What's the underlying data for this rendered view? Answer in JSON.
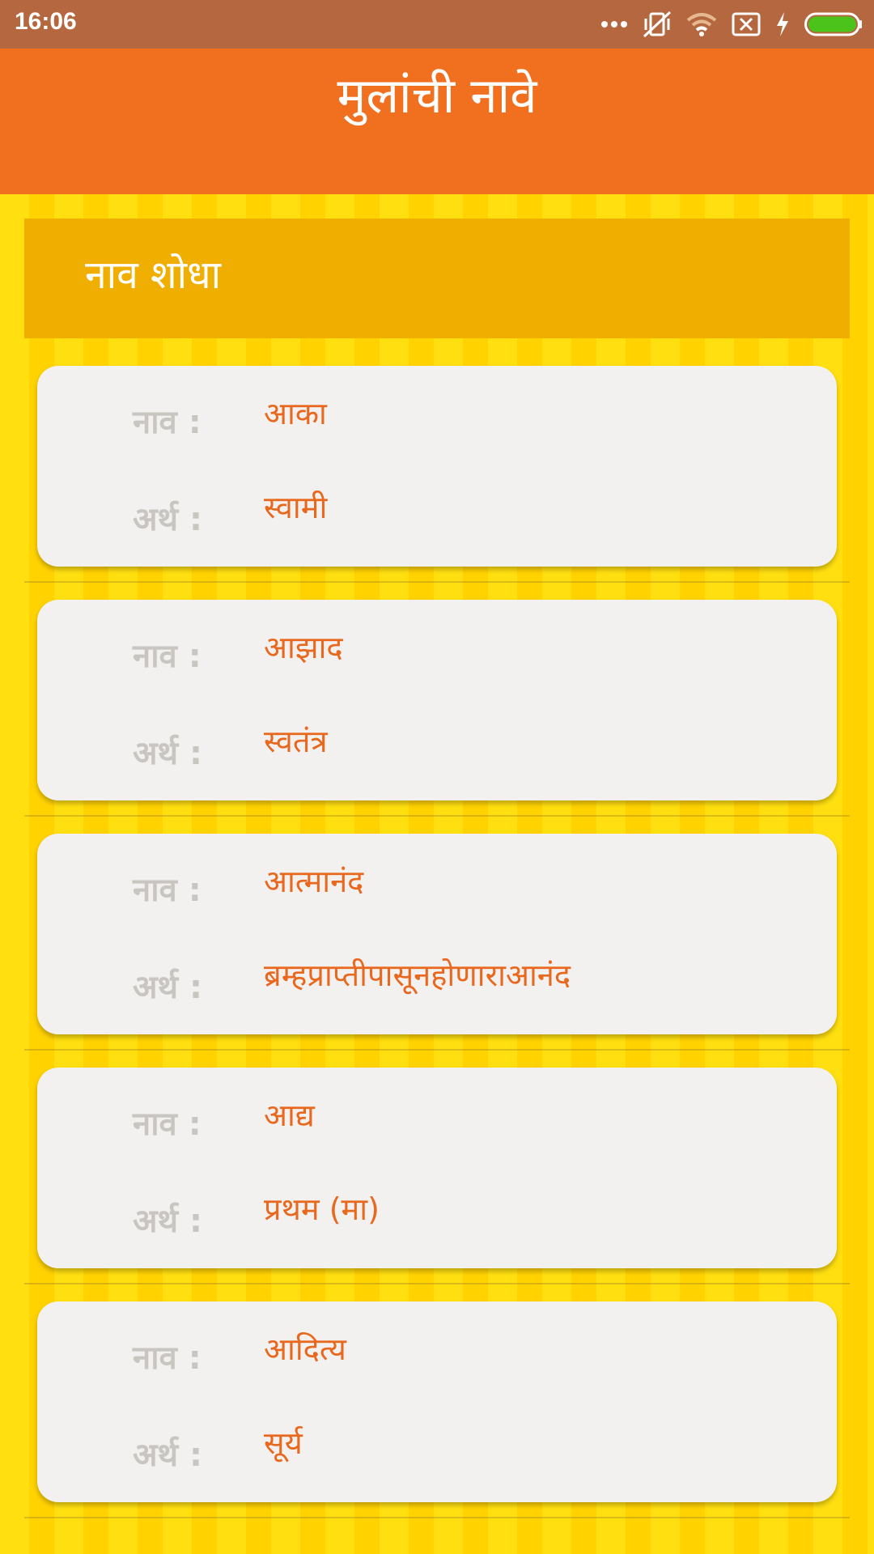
{
  "status_bar": {
    "time": "16:06",
    "icons": [
      "more-dots-icon",
      "vibrate-off-icon",
      "wifi-icon",
      "no-sim-icon",
      "charging-icon",
      "battery-icon"
    ],
    "battery_color": "#4CC31A"
  },
  "app_bar": {
    "title": "मुलांची नावे",
    "color": "#F17020"
  },
  "search": {
    "label": "नाव शोधा"
  },
  "names": [
    {
      "name_label": "नाव :",
      "name": "आका",
      "meaning_label": "अर्थ :",
      "meaning": "स्वामी"
    },
    {
      "name_label": "नाव :",
      "name": "आझाद",
      "meaning_label": "अर्थ :",
      "meaning": "स्वतंत्र"
    },
    {
      "name_label": "नाव :",
      "name": "आत्मानंद",
      "meaning_label": "अर्थ :",
      "meaning": "ब्रम्हप्राप्तीपासूनहोणाराआनंद"
    },
    {
      "name_label": "नाव :",
      "name": "आद्य",
      "meaning_label": "अर्थ :",
      "meaning": "प्रथम (मा)"
    },
    {
      "name_label": "नाव :",
      "name": "आदित्य",
      "meaning_label": "अर्थ :",
      "meaning": "सूर्य"
    }
  ]
}
